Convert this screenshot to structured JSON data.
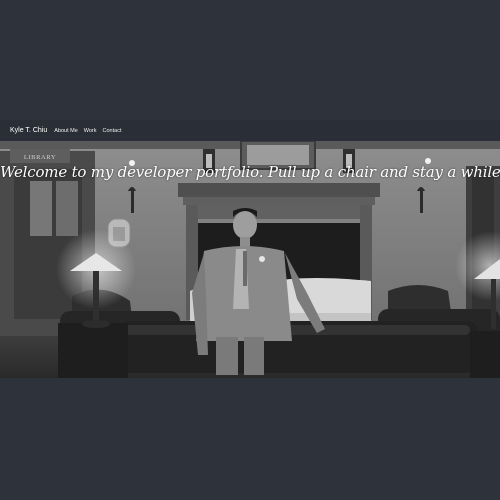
{
  "nav": {
    "brand": "Kyle T. Chiu",
    "links": [
      "About Me",
      "Work",
      "Contact"
    ]
  },
  "hero": {
    "headline": "Welcome to my developer portfolio. Pull up a chair and stay a while.",
    "sign_text": "LIBRARY"
  },
  "colors": {
    "page_background": "#2e323b",
    "navbar_background": "#2a2e36",
    "text": "#ffffff"
  }
}
